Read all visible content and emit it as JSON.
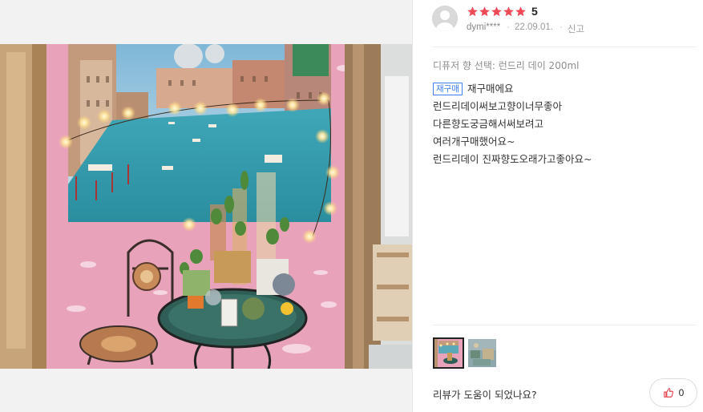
{
  "review": {
    "rating": "5",
    "stars_filled": 5,
    "star_color": "#f04a57",
    "username": "dymi****",
    "date": "22.09.01.",
    "report_label": "신고",
    "option_label": "디퓨저 향 선택: 런드리 데이 200ml",
    "repurchase_badge": "재구매",
    "lines": [
      "재구매에요",
      "런드리데이써보고향이너무좋아",
      "다른향도궁금해서써보려고",
      "여러개구매했어요~",
      "런드리데이 진짜향도오래가고좋아요~"
    ],
    "helpful_question": "리뷰가 도움이 되었나요?",
    "like_count": "0"
  },
  "icons": {
    "avatar": "user-avatar-icon",
    "star": "star-icon",
    "like": "thumbs-up-icon"
  },
  "colors": {
    "accent_blue": "#3d7df0",
    "like_icon": "#e8474f"
  }
}
